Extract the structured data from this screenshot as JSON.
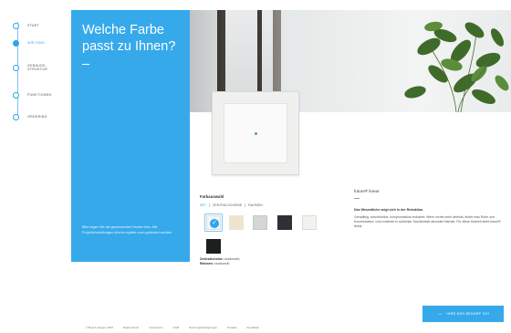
{
  "nav": {
    "items": [
      {
        "label": "Start",
        "active": false
      },
      {
        "label": "Wir sind",
        "active": true
      },
      {
        "label": "Gebäude-Struktur",
        "active": false
      },
      {
        "label": "Funktionen",
        "active": false
      },
      {
        "label": "Ordering",
        "active": false
      }
    ]
  },
  "hero": {
    "headline_line1": "Welche Farbe",
    "headline_line2": "passt zu Ihnen?",
    "body": "Bitte legen Sie die gewünschten Farben fest. Alle Projekteinstellungen können später noch geändert werden."
  },
  "selection": {
    "title": "Farbauswahl",
    "tabs": [
      {
        "label": "Set",
        "active": true
      },
      {
        "label": "Zentralscheibe",
        "active": false
      },
      {
        "label": "Rahmen",
        "active": false
      }
    ],
    "swatches": [
      {
        "name": "studioweiß",
        "color": "#f4f4f4",
        "selected": true
      },
      {
        "name": "elfenbein",
        "color": "#eee5cf",
        "selected": false
      },
      {
        "name": "alu",
        "color": "#d5d6d7",
        "selected": false
      },
      {
        "name": "anthrazit",
        "color": "#2d3136",
        "selected": false
      },
      {
        "name": "weiß",
        "color": "#f2f2ee",
        "selected": false
      },
      {
        "name": "schwarz",
        "color": "#1d1e20",
        "selected": false
      }
    ],
    "info_label_1": "Zentralscheibe:",
    "info_value_1": "studioweiß",
    "info_label_2": "Rahmen:",
    "info_value_2": "studioweiß"
  },
  "product": {
    "name": "future® linear",
    "subheading": "Das Wesentliche zeigt sich in der Reduktion.",
    "body": "Geradlinig, schnörkellos, kompromisslos reduziert: Wenn nichts mehr ablenkt, findet man Ruhe und Konzentration. Und entdeckt in schlichter Sachlichkeit absolute Klarheit. Für diese Klarheit steht future® linear."
  },
  "cta": {
    "label": "Ihre den Bedarf ich"
  },
  "footer": {
    "links": [
      "© Busch-Jaeger 2022",
      "Datenschutz",
      "Impressum",
      "AGB",
      "Nutzungsbedingungen",
      "Kontakt",
      "Feedback"
    ]
  },
  "colors": {
    "accent": "#36a9eb",
    "led": "#4ab05a"
  }
}
